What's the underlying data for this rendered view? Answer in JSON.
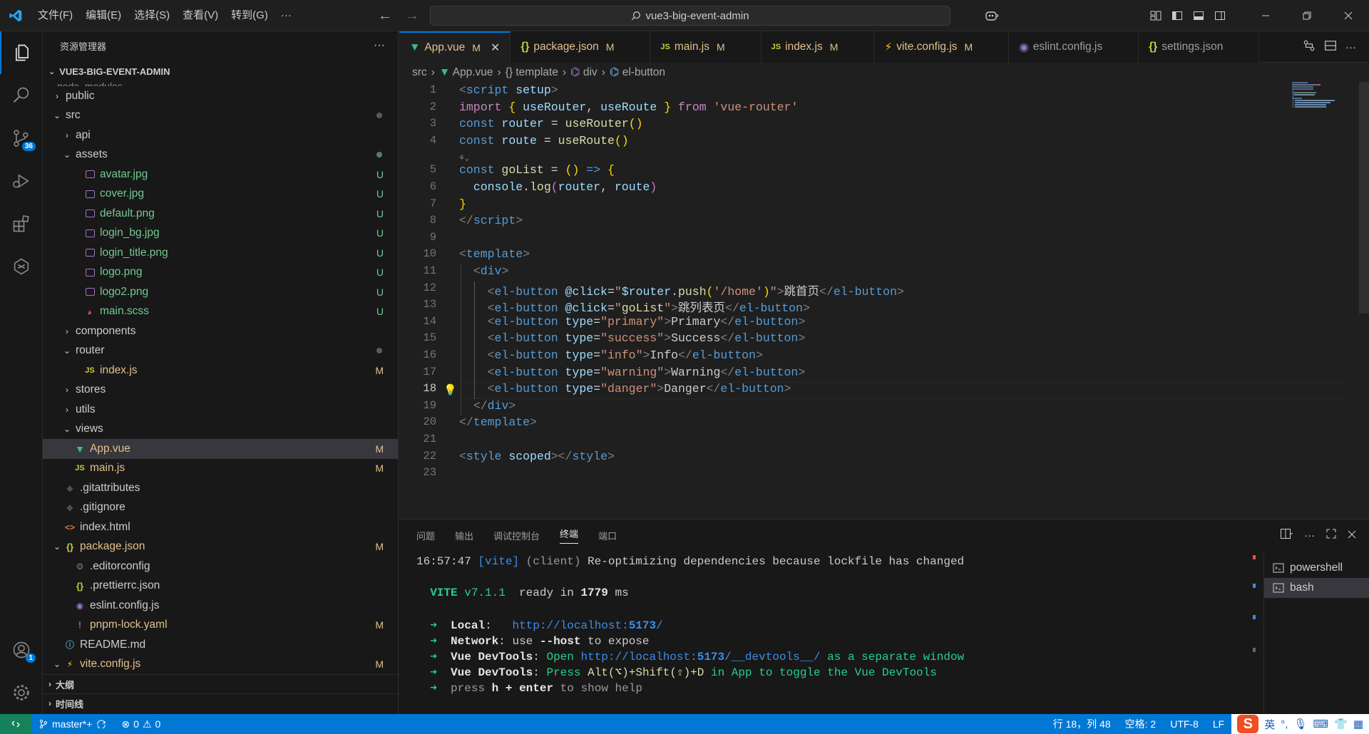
{
  "titlebar": {
    "menu": [
      "文件(F)",
      "编辑(E)",
      "选择(S)",
      "查看(V)",
      "转到(G)",
      "···"
    ],
    "search": "vue3-big-event-admin",
    "accent": "#0078d4"
  },
  "activity": {
    "scm_badge": "36",
    "account_badge": "1"
  },
  "sidebar": {
    "title": "资源管理器",
    "more": "···",
    "root": "VUE3-BIG-EVENT-ADMIN",
    "partial_top": "node_modules",
    "items": [
      {
        "label": "public",
        "indent": 1,
        "kind": "folder",
        "open": false,
        "status": ""
      },
      {
        "label": "src",
        "indent": 1,
        "kind": "folder",
        "open": true,
        "status": "",
        "dot": "gray"
      },
      {
        "label": "api",
        "indent": 2,
        "kind": "folder",
        "open": false,
        "status": ""
      },
      {
        "label": "assets",
        "indent": 2,
        "kind": "folder",
        "open": true,
        "status": "",
        "dot": "green"
      },
      {
        "label": "avatar.jpg",
        "indent": 3,
        "kind": "img",
        "status": "U"
      },
      {
        "label": "cover.jpg",
        "indent": 3,
        "kind": "img",
        "status": "U"
      },
      {
        "label": "default.png",
        "indent": 3,
        "kind": "img",
        "status": "U"
      },
      {
        "label": "login_bg.jpg",
        "indent": 3,
        "kind": "img",
        "status": "U"
      },
      {
        "label": "login_title.png",
        "indent": 3,
        "kind": "img",
        "status": "U"
      },
      {
        "label": "logo.png",
        "indent": 3,
        "kind": "img",
        "status": "U"
      },
      {
        "label": "logo2.png",
        "indent": 3,
        "kind": "img",
        "status": "U"
      },
      {
        "label": "main.scss",
        "indent": 3,
        "kind": "scss",
        "status": "U"
      },
      {
        "label": "components",
        "indent": 2,
        "kind": "folder",
        "open": false,
        "status": ""
      },
      {
        "label": "router",
        "indent": 2,
        "kind": "folder",
        "open": true,
        "status": "",
        "dot": "gray"
      },
      {
        "label": "index.js",
        "indent": 3,
        "kind": "js",
        "status": "M"
      },
      {
        "label": "stores",
        "indent": 2,
        "kind": "folder",
        "open": false,
        "status": ""
      },
      {
        "label": "utils",
        "indent": 2,
        "kind": "folder",
        "open": false,
        "status": ""
      },
      {
        "label": "views",
        "indent": 2,
        "kind": "folder",
        "open": true,
        "status": ""
      },
      {
        "label": "App.vue",
        "indent": 2,
        "kind": "vue",
        "status": "M",
        "selected": true
      },
      {
        "label": "main.js",
        "indent": 2,
        "kind": "js",
        "status": "M"
      },
      {
        "label": ".gitattributes",
        "indent": 1,
        "kind": "git",
        "status": ""
      },
      {
        "label": ".gitignore",
        "indent": 1,
        "kind": "git",
        "status": ""
      },
      {
        "label": "index.html",
        "indent": 1,
        "kind": "html",
        "status": ""
      },
      {
        "label": "package.json",
        "indent": 1,
        "kind": "json",
        "open": true,
        "folderish": true,
        "status": "M"
      },
      {
        "label": ".editorconfig",
        "indent": 2,
        "kind": "gear",
        "status": ""
      },
      {
        "label": ".prettierrc.json",
        "indent": 2,
        "kind": "json",
        "status": ""
      },
      {
        "label": "eslint.config.js",
        "indent": 2,
        "kind": "eslint",
        "status": ""
      },
      {
        "label": "pnpm-lock.yaml",
        "indent": 2,
        "kind": "yaml",
        "status": "M"
      },
      {
        "label": "README.md",
        "indent": 1,
        "kind": "info",
        "status": ""
      },
      {
        "label": "vite.config.js",
        "indent": 1,
        "kind": "vite",
        "open": true,
        "folderish": true,
        "status": "M"
      }
    ],
    "outline": "大纲",
    "timeline": "时间线"
  },
  "tabs": [
    {
      "label": "App.vue",
      "status": "M",
      "icon": "vue",
      "active": true
    },
    {
      "label": "package.json",
      "status": "M",
      "icon": "json"
    },
    {
      "label": "main.js",
      "status": "M",
      "icon": "js"
    },
    {
      "label": "index.js",
      "status": "M",
      "icon": "js"
    },
    {
      "label": "vite.config.js",
      "status": "M",
      "icon": "vite"
    },
    {
      "label": "eslint.config.js",
      "status": "",
      "icon": "eslint"
    },
    {
      "label": "settings.json",
      "status": "",
      "icon": "json"
    }
  ],
  "breadcrumb": [
    "src",
    "App.vue",
    "template",
    "div",
    "el-button"
  ],
  "editor": {
    "current_line": "18",
    "lines": [
      {
        "n": "1",
        "html": "<span class='g'>&lt;</span><span class='t'>script</span> <span class='a'>setup</span><span class='g'>&gt;</span>"
      },
      {
        "n": "2",
        "html": "<span class='ctl'>import</span> <span class='b1'>{</span> <span class='v'>useRouter</span>, <span class='v'>useRoute</span> <span class='b1'>}</span> <span class='ctl'>from</span> <span class='s'>'vue-router'</span>"
      },
      {
        "n": "3",
        "html": "<span class='k'>const</span> <span class='v'>router</span> = <span class='f'>useRouter</span><span class='b1'>()</span>"
      },
      {
        "n": "4",
        "html": "<span class='k'>const</span> <span class='v'>route</span> = <span class='f'>useRoute</span><span class='b1'>()</span>"
      },
      {
        "n": "",
        "html": "<span class='g' style='font-size:12px'>⚘⌄</span>"
      },
      {
        "n": "5",
        "html": "<span class='k'>const</span> <span class='f'>goList</span> = <span class='b1'>()</span> <span class='k'>=&gt;</span> <span class='b1'>{</span>"
      },
      {
        "n": "6",
        "html": "  <span class='v'>console</span>.<span class='f'>log</span><span class='b2'>(</span><span class='v'>router</span>, <span class='v'>route</span><span class='b2'>)</span>"
      },
      {
        "n": "7",
        "html": "<span class='b1'>}</span>"
      },
      {
        "n": "8",
        "html": "<span class='g'>&lt;/</span><span class='t'>script</span><span class='g'>&gt;</span>"
      },
      {
        "n": "9",
        "html": ""
      },
      {
        "n": "10",
        "html": "<span class='g'>&lt;</span><span class='t'>template</span><span class='g'>&gt;</span>"
      },
      {
        "n": "11",
        "html": "  <span class='g'>&lt;</span><span class='t'>div</span><span class='g'>&gt;</span>"
      },
      {
        "n": "12",
        "html": "    <span class='g'>&lt;</span><span class='t'>el-button</span> <span class='a'>@click</span>=<span class='s'>\"</span><span class='v'>$router</span>.<span class='f'>push</span><span class='b1'>(</span><span class='s'>'/home'</span><span class='b1'>)</span><span class='s'>\"</span><span class='g'>&gt;</span>跳首页<span class='g'>&lt;/</span><span class='t'>el-button</span><span class='g'>&gt;</span>"
      },
      {
        "n": "13",
        "html": "    <span class='g'>&lt;</span><span class='t'>el-button</span> <span class='a'>@click</span>=<span class='s'>\"</span><span class='f'>goList</span><span class='s'>\"</span><span class='g'>&gt;</span>跳列表页<span class='g'>&lt;/</span><span class='t'>el-button</span><span class='g'>&gt;</span>"
      },
      {
        "n": "14",
        "html": "    <span class='g'>&lt;</span><span class='t'>el-button</span> <span class='a'>type</span>=<span class='s'>\"primary\"</span><span class='g'>&gt;</span>Primary<span class='g'>&lt;/</span><span class='t'>el-button</span><span class='g'>&gt;</span>"
      },
      {
        "n": "15",
        "html": "    <span class='g'>&lt;</span><span class='t'>el-button</span> <span class='a'>type</span>=<span class='s'>\"success\"</span><span class='g'>&gt;</span>Success<span class='g'>&lt;/</span><span class='t'>el-button</span><span class='g'>&gt;</span>"
      },
      {
        "n": "16",
        "html": "    <span class='g'>&lt;</span><span class='t'>el-button</span> <span class='a'>type</span>=<span class='s'>\"info\"</span><span class='g'>&gt;</span>Info<span class='g'>&lt;/</span><span class='t'>el-button</span><span class='g'>&gt;</span>"
      },
      {
        "n": "17",
        "html": "    <span class='g'>&lt;</span><span class='t'>el-button</span> <span class='a'>type</span>=<span class='s'>\"warning\"</span><span class='g'>&gt;</span>Warning<span class='g'>&lt;/</span><span class='t'>el-button</span><span class='g'>&gt;</span>"
      },
      {
        "n": "18",
        "html": "    <span class='g'>&lt;</span><span class='t'>el-button</span> <span class='a'>type</span>=<span class='s'>\"danger\"</span><span class='g'>&gt;</span>Danger<span class='g'>&lt;/</span><span class='t'>el-button</span><span class='g'>&gt;</span>"
      },
      {
        "n": "19",
        "html": "  <span class='g'>&lt;/</span><span class='t'>div</span><span class='g'>&gt;</span>"
      },
      {
        "n": "20",
        "html": "<span class='g'>&lt;/</span><span class='t'>template</span><span class='g'>&gt;</span>"
      },
      {
        "n": "21",
        "html": ""
      },
      {
        "n": "22",
        "html": "<span class='g'>&lt;</span><span class='t'>style</span> <span class='a'>scoped</span><span class='g'>&gt;&lt;/</span><span class='t'>style</span><span class='g'>&gt;</span>"
      },
      {
        "n": "23",
        "html": ""
      }
    ]
  },
  "panel": {
    "tabs": [
      "问题",
      "输出",
      "调试控制台",
      "终端",
      "端口"
    ],
    "active_tab": "终端",
    "terminal_lines": [
      {
        "html": "16:57:47 <span class='tc'>[vite]</span> <span class='td'>(client)</span> Re-optimizing dependencies because lockfile has changed"
      },
      {
        "html": ""
      },
      {
        "html": "  <span class='tgr' style='font-weight:bold'>VITE</span> <span class='tgr'>v7.1.1</span>  ready in <span class='tb'>1779</span> ms"
      },
      {
        "html": ""
      },
      {
        "html": "  <span class='tgr'>➜</span>  <span class='tb'>Local</span>:   <span class='tc'>http://localhost:<b>5173</b>/</span>"
      },
      {
        "html": "  <span class='tgr'>➜</span>  <span class='tb'>Network</span>: use <span class='tb'>--host</span> to expose"
      },
      {
        "html": "  <span class='tgr'>➜</span>  <span class='tb'>Vue DevTools</span>: <span class='tgr'>Open</span> <span class='tc'>http://localhost:<b>5173</b>/__devtools__/</span> <span class='tgr'>as a separate window</span>"
      },
      {
        "html": "  <span class='tgr'>➜</span>  <span class='tb'>Vue DevTools</span>: <span class='tgr'>Press</span> <span class='f'>Alt(⌥)+Shift(⇧)+D</span> <span class='tgr'>in App to toggle the Vue DevTools</span>"
      },
      {
        "html": "  <span class='tgr'>➜</span>  <span class='td'>press</span> <span class='tb'>h + enter</span> <span class='td'>to show help</span>"
      }
    ],
    "terminals": [
      {
        "label": "powershell",
        "selected": false
      },
      {
        "label": "bash",
        "selected": true
      }
    ]
  },
  "statusbar": {
    "branch": "master*+",
    "errors": "0",
    "warnings": "0",
    "position": "行 18，列 48",
    "spaces": "空格: 2",
    "encoding": "UTF-8",
    "eol": "LF",
    "ime_lang": "英",
    "ime_punct": "°,"
  }
}
